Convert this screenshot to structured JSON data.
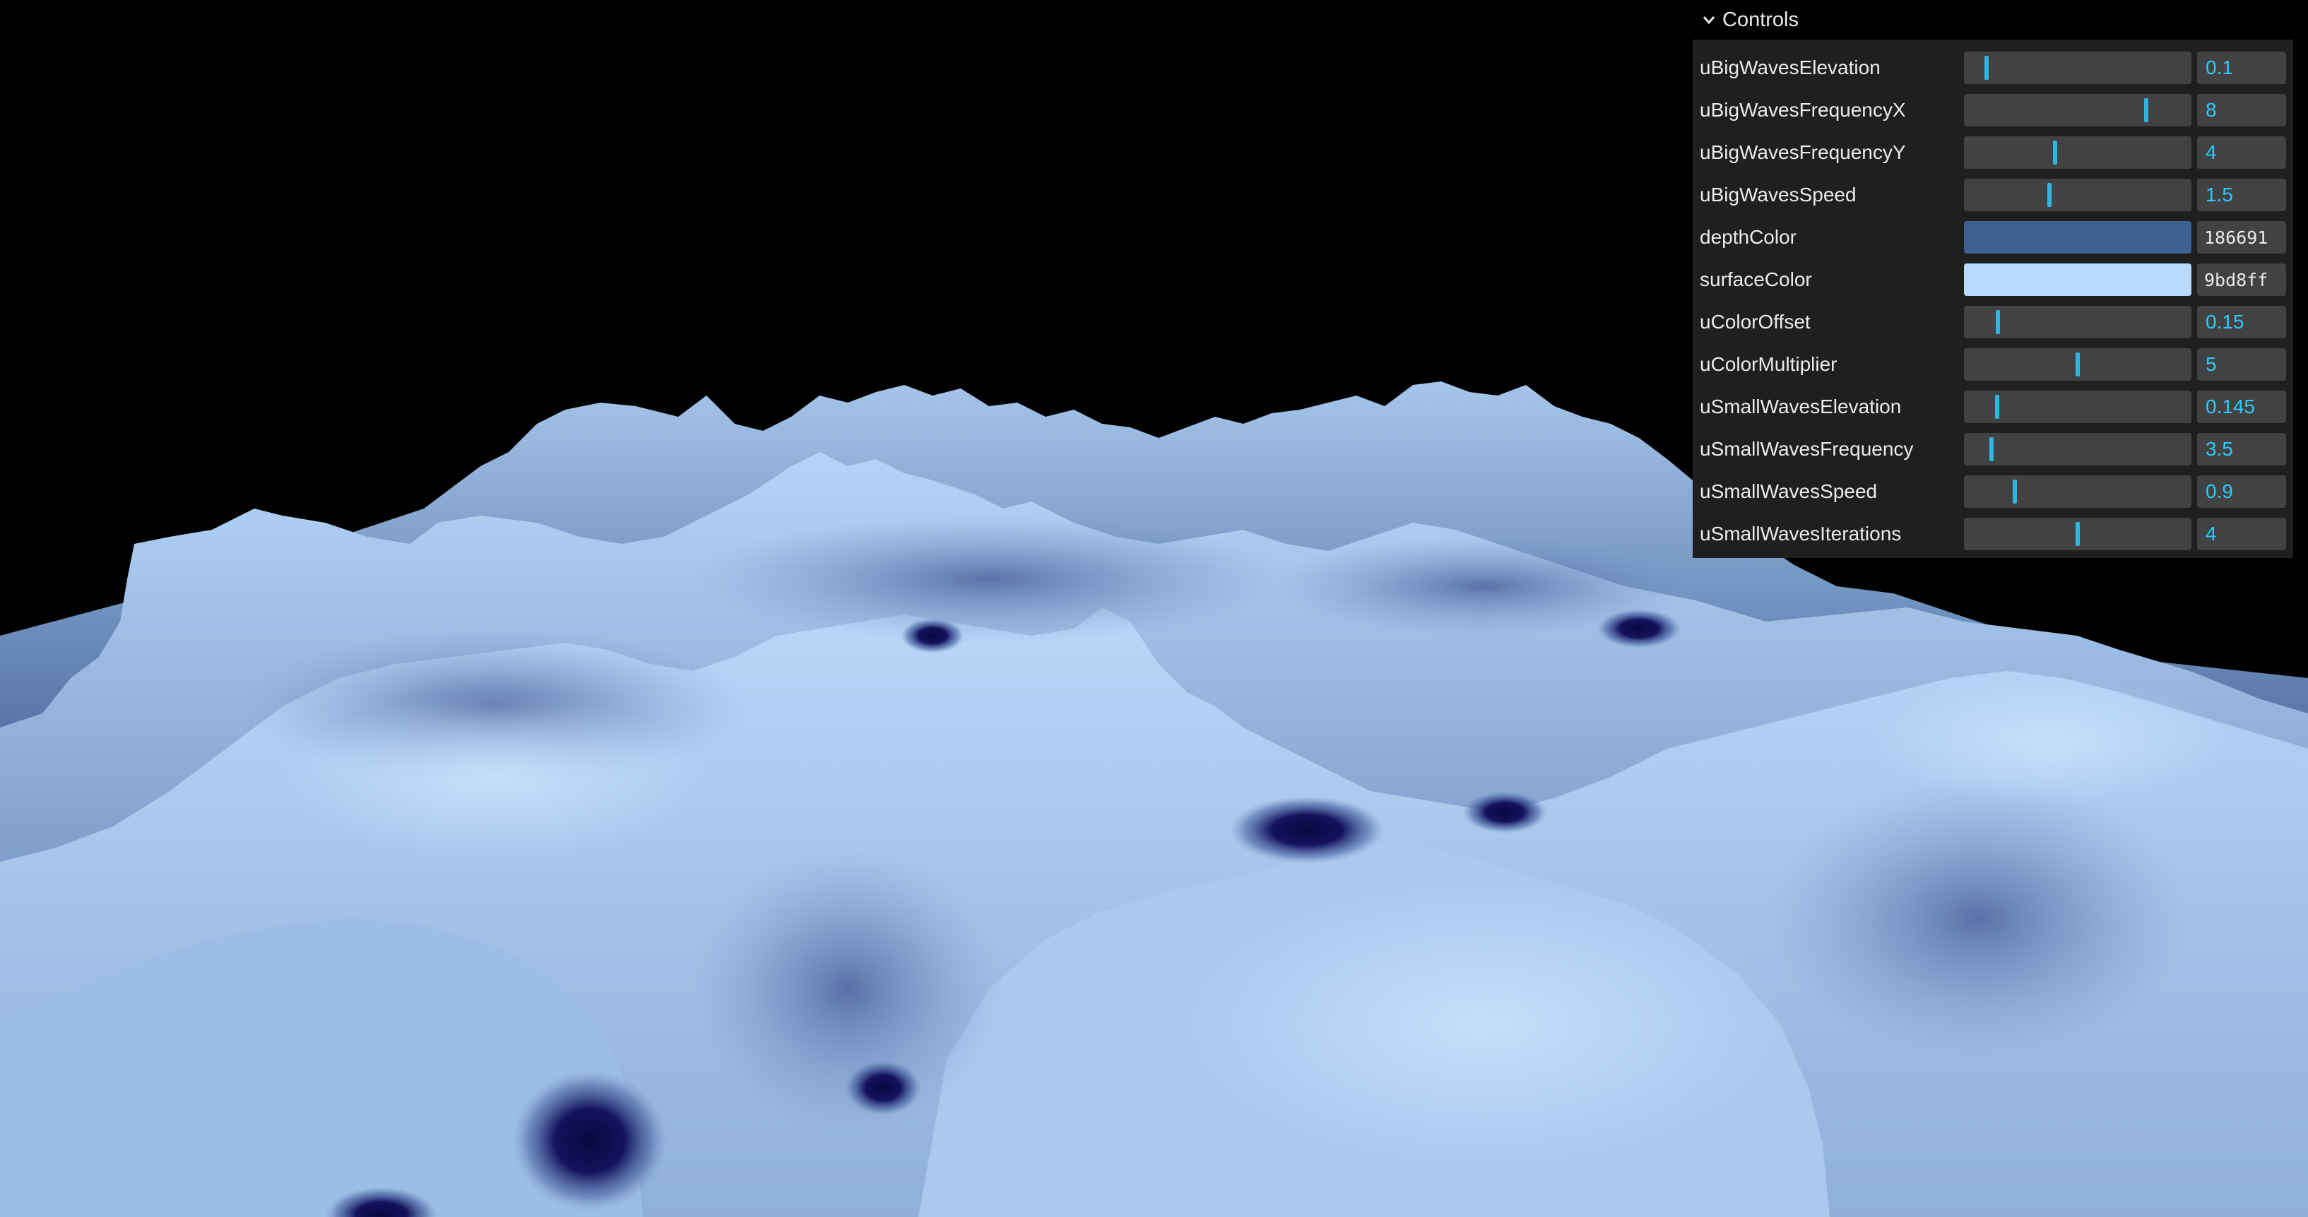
{
  "gui": {
    "title": "Controls",
    "controls": [
      {
        "label": "uBigWavesElevation",
        "type": "slider",
        "value": "0.1",
        "fraction": 0.1
      },
      {
        "label": "uBigWavesFrequencyX",
        "type": "slider",
        "value": "8",
        "fraction": 0.8
      },
      {
        "label": "uBigWavesFrequencyY",
        "type": "slider",
        "value": "4",
        "fraction": 0.4
      },
      {
        "label": "uBigWavesSpeed",
        "type": "slider",
        "value": "1.5",
        "fraction": 0.375
      },
      {
        "label": "depthColor",
        "type": "color",
        "value": "186691",
        "color": "#3d6291"
      },
      {
        "label": "surfaceColor",
        "type": "color",
        "value": "9bd8ff",
        "color": "#b7dbfd"
      },
      {
        "label": "uColorOffset",
        "type": "slider",
        "value": "0.15",
        "fraction": 0.15
      },
      {
        "label": "uColorMultiplier",
        "type": "slider",
        "value": "5",
        "fraction": 0.5
      },
      {
        "label": "uSmallWavesElevation",
        "type": "slider",
        "value": "0.145",
        "fraction": 0.145
      },
      {
        "label": "uSmallWavesFrequency",
        "type": "slider",
        "value": "3.5",
        "fraction": 0.12
      },
      {
        "label": "uSmallWavesSpeed",
        "type": "slider",
        "value": "0.9",
        "fraction": 0.225
      },
      {
        "label": "uSmallWavesIterations",
        "type": "slider",
        "value": "4",
        "fraction": 0.5
      }
    ]
  },
  "colors": {
    "background": "#000000",
    "panel": "#1f1f1f",
    "accent": "#2cc9ff",
    "surface_light": "#b9dcfb",
    "surface_mid": "#87a9d3",
    "depth_dark": "#0e0b55"
  },
  "icons": {
    "collapse": "chevron-down-icon"
  }
}
